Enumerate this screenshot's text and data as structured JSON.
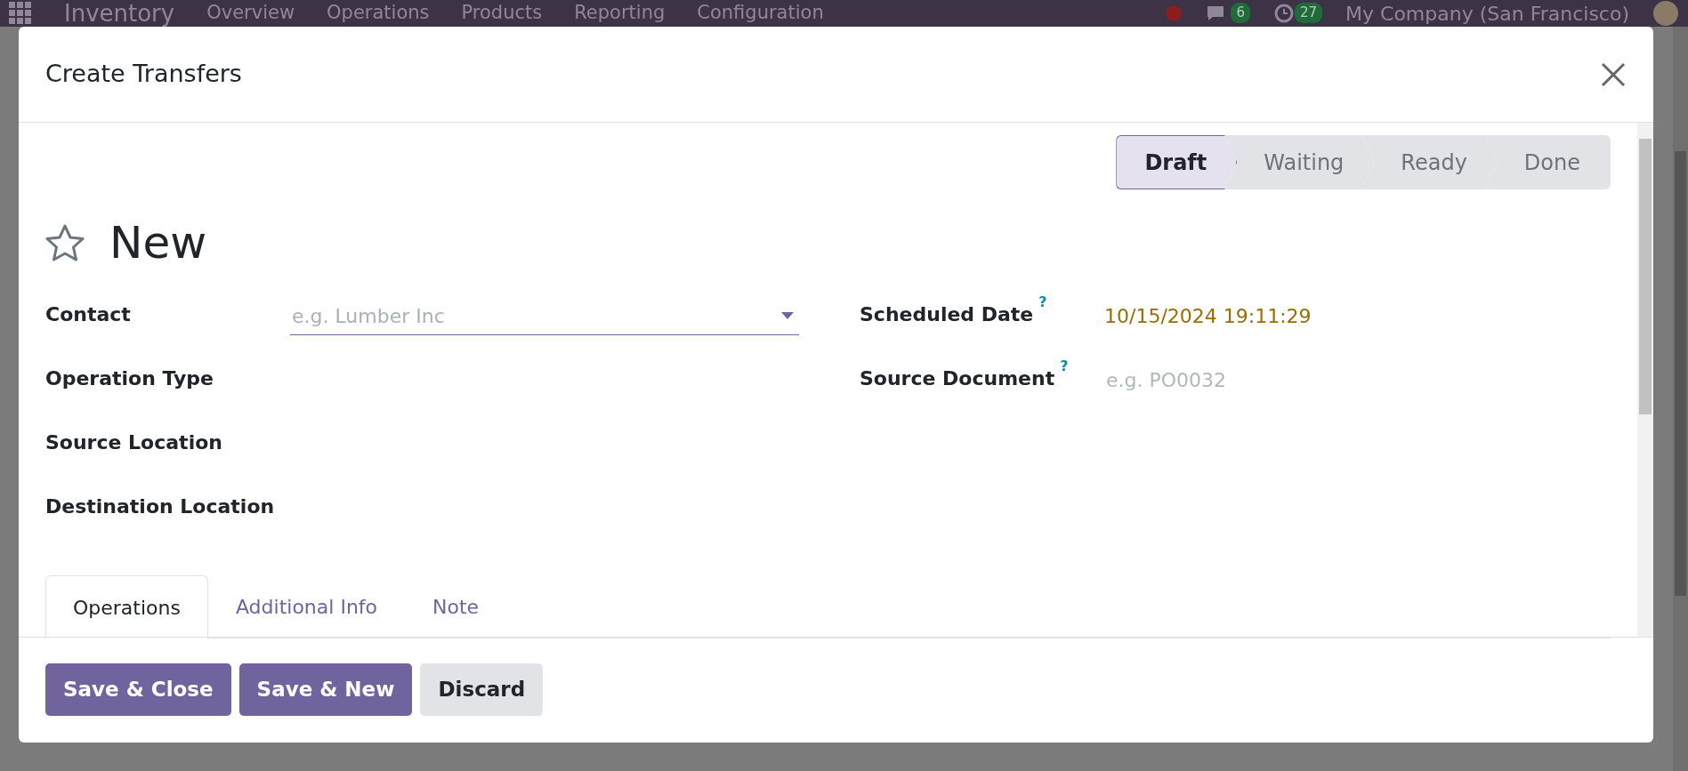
{
  "navbar": {
    "app": "Inventory",
    "menus": [
      "Overview",
      "Operations",
      "Products",
      "Reporting",
      "Configuration"
    ],
    "messages_count": "6",
    "activities_count": "27",
    "company": "My Company (San Francisco)"
  },
  "dialog": {
    "title": "Create Transfers",
    "stages": [
      {
        "label": "Draft",
        "selected": true
      },
      {
        "label": "Waiting",
        "selected": false
      },
      {
        "label": "Ready",
        "selected": false
      },
      {
        "label": "Done",
        "selected": false
      }
    ],
    "record_name": "New",
    "starred": false,
    "left_fields": [
      {
        "label": "Contact",
        "kind": "dropdown",
        "placeholder": "e.g. Lumber Inc"
      },
      {
        "label": "Operation Type",
        "kind": "empty"
      },
      {
        "label": "Source Location",
        "kind": "empty"
      },
      {
        "label": "Destination Location",
        "kind": "empty"
      }
    ],
    "right_fields": [
      {
        "label": "Scheduled Date",
        "help": "?",
        "kind": "value",
        "value": "10/15/2024 19:11:29"
      },
      {
        "label": "Source Document",
        "help": "?",
        "kind": "placeholder",
        "placeholder": "e.g. PO0032"
      }
    ],
    "tabs": [
      {
        "label": "Operations",
        "selected": true
      },
      {
        "label": "Additional Info",
        "selected": false
      },
      {
        "label": "Note",
        "selected": false
      }
    ],
    "buttons": [
      {
        "label": "Save & Close",
        "kind": "primary"
      },
      {
        "label": "Save & New",
        "kind": "primary"
      },
      {
        "label": "Discard",
        "kind": "secondary"
      }
    ]
  }
}
